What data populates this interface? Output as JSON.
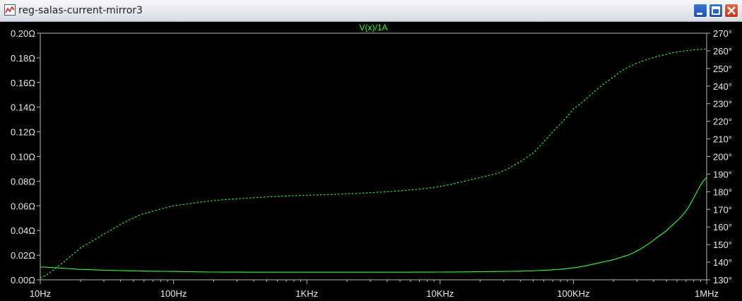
{
  "window": {
    "title": "reg-salas-current-mirror3"
  },
  "colors": {
    "trace": "#33ff33",
    "background": "#000000",
    "axis": "#b8b8b8",
    "label": "#e8e8e8"
  },
  "chart_data": {
    "type": "line",
    "title": "V(x)/1A",
    "xscale": "log",
    "xlim": [
      10,
      1000000
    ],
    "xticks": [
      "10Hz",
      "100Hz",
      "1KHz",
      "10KHz",
      "100KHz",
      "1MHz"
    ],
    "ylim_left": [
      0,
      0.2
    ],
    "yticks_left": [
      "0.00Ω",
      "0.02Ω",
      "0.04Ω",
      "0.06Ω",
      "0.08Ω",
      "0.10Ω",
      "0.12Ω",
      "0.14Ω",
      "0.16Ω",
      "0.18Ω",
      "0.20Ω"
    ],
    "ylim_right": [
      130,
      270
    ],
    "yticks_right": [
      "130°",
      "140°",
      "150°",
      "160°",
      "170°",
      "180°",
      "190°",
      "200°",
      "210°",
      "220°",
      "230°",
      "240°",
      "250°",
      "260°",
      "270°"
    ],
    "series": [
      {
        "style": "solid",
        "axis": "left",
        "x": [
          10,
          20,
          50,
          100,
          200,
          500,
          1000,
          2000,
          5000,
          10000,
          20000,
          50000,
          100000,
          200000,
          300000,
          500000,
          700000,
          1000000
        ],
        "y": [
          0.0104,
          0.0085,
          0.0072,
          0.0068,
          0.0063,
          0.0062,
          0.0062,
          0.0062,
          0.0062,
          0.0063,
          0.0066,
          0.0073,
          0.0097,
          0.0163,
          0.0235,
          0.0398,
          0.056,
          0.083
        ]
      },
      {
        "style": "dashed",
        "axis": "right",
        "x": [
          10,
          15,
          20,
          30,
          50,
          70,
          100,
          200,
          500,
          1000,
          2000,
          5000,
          10000,
          20000,
          30000,
          50000,
          70000,
          100000,
          200000,
          300000,
          500000,
          700000,
          1000000
        ],
        "y": [
          131,
          140,
          148,
          156,
          165,
          169,
          172,
          175,
          177,
          178,
          178.8,
          180.5,
          183,
          188,
          192,
          202,
          214,
          227,
          245,
          253,
          258,
          260,
          261
        ]
      }
    ]
  }
}
